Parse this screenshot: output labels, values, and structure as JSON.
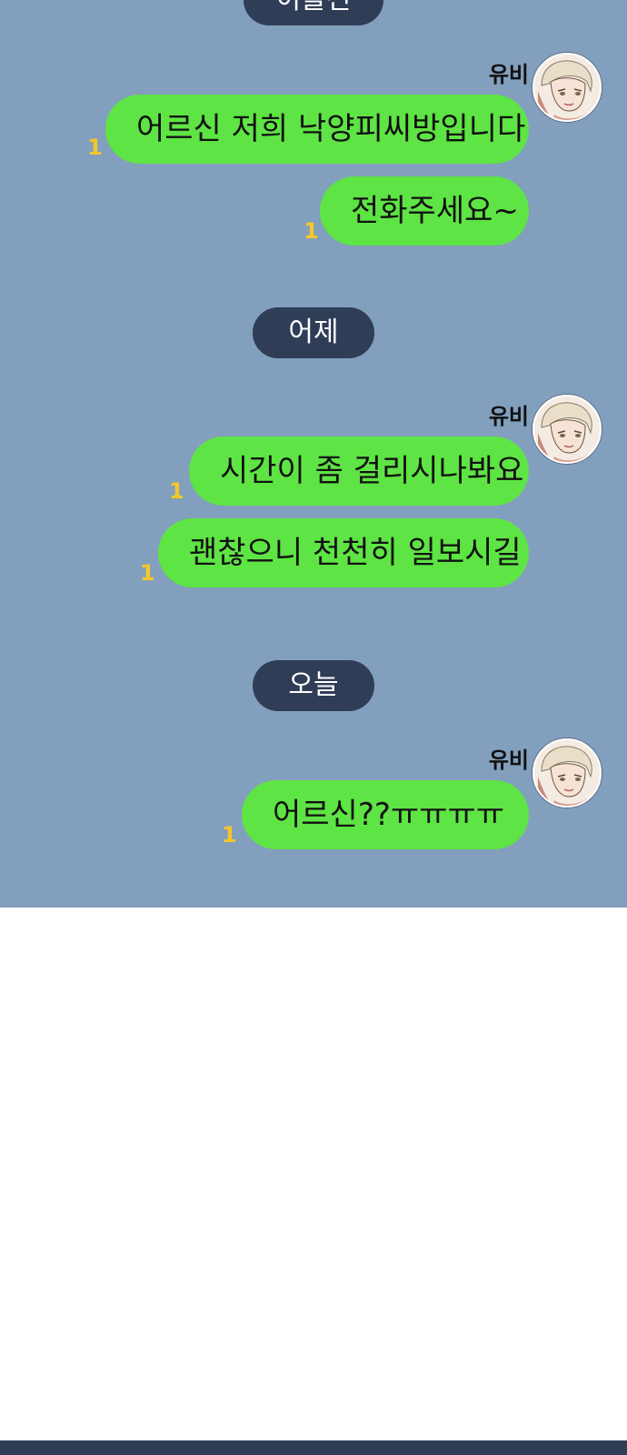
{
  "colors": {
    "chat_background": "#829fbd",
    "bubble": "#5ee444",
    "date_pill": "#2f3d56",
    "unread_count": "#f6c62a"
  },
  "date_dividers": [
    {
      "label": "이틀전"
    },
    {
      "label": "어제"
    },
    {
      "label": "오늘"
    }
  ],
  "groups": [
    {
      "sender": "유비",
      "messages": [
        {
          "text": "어르신 저희 낙양피씨방입니다",
          "unread": "1"
        },
        {
          "text": "전화주세요~",
          "unread": "1"
        }
      ]
    },
    {
      "sender": "유비",
      "messages": [
        {
          "text": "시간이 좀 걸리시나봐요",
          "unread": "1"
        },
        {
          "text": "괜찮으니 천천히 일보시길",
          "unread": "1"
        }
      ]
    },
    {
      "sender": "유비",
      "messages": [
        {
          "text": "어르신??ㅠㅠㅠㅠ",
          "unread": "1"
        }
      ]
    }
  ]
}
